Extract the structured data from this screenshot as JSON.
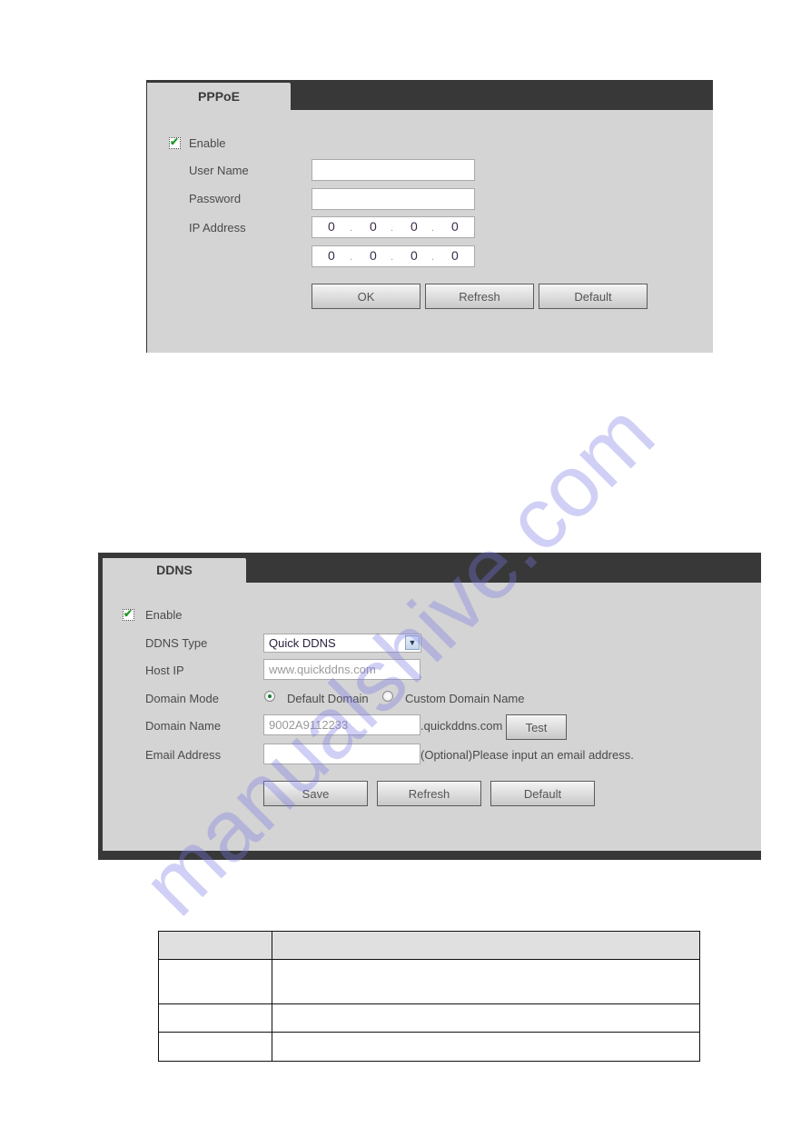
{
  "pppoe": {
    "tab_label": "PPPoE",
    "enable_label": "Enable",
    "enable_checked": true,
    "fields": {
      "user_name_label": "User Name",
      "user_name_value": "",
      "password_label": "Password",
      "password_value": "",
      "ip_address_label": "IP Address",
      "ip_address_1": [
        "0",
        "0",
        "0",
        "0"
      ],
      "ip_address_2": [
        "0",
        "0",
        "0",
        "0"
      ]
    },
    "buttons": {
      "ok": "OK",
      "refresh": "Refresh",
      "default": "Default"
    }
  },
  "ddns": {
    "tab_label": "DDNS",
    "enable_label": "Enable",
    "enable_checked": true,
    "ddns_type_label": "DDNS Type",
    "ddns_type_value": "Quick DDNS",
    "host_ip_label": "Host IP",
    "host_ip_value": "www.quickddns.com",
    "domain_mode_label": "Domain Mode",
    "domain_mode_options": [
      "Default Domain",
      "Custom Domain Name"
    ],
    "domain_mode_selected": "Default Domain",
    "domain_name_label": "Domain Name",
    "domain_name_value": "9002A9112233",
    "domain_suffix": ".quickddns.com",
    "test_button": "Test",
    "email_label": "Email Address",
    "email_value": "",
    "email_hint": "(Optional)Please input an email address.",
    "buttons": {
      "save": "Save",
      "refresh": "Refresh",
      "default": "Default"
    }
  },
  "table": {
    "header": [
      "",
      ""
    ],
    "rows": [
      [
        "",
        ""
      ],
      [
        "",
        ""
      ],
      [
        "",
        ""
      ]
    ]
  },
  "watermark": "manualshive.com"
}
